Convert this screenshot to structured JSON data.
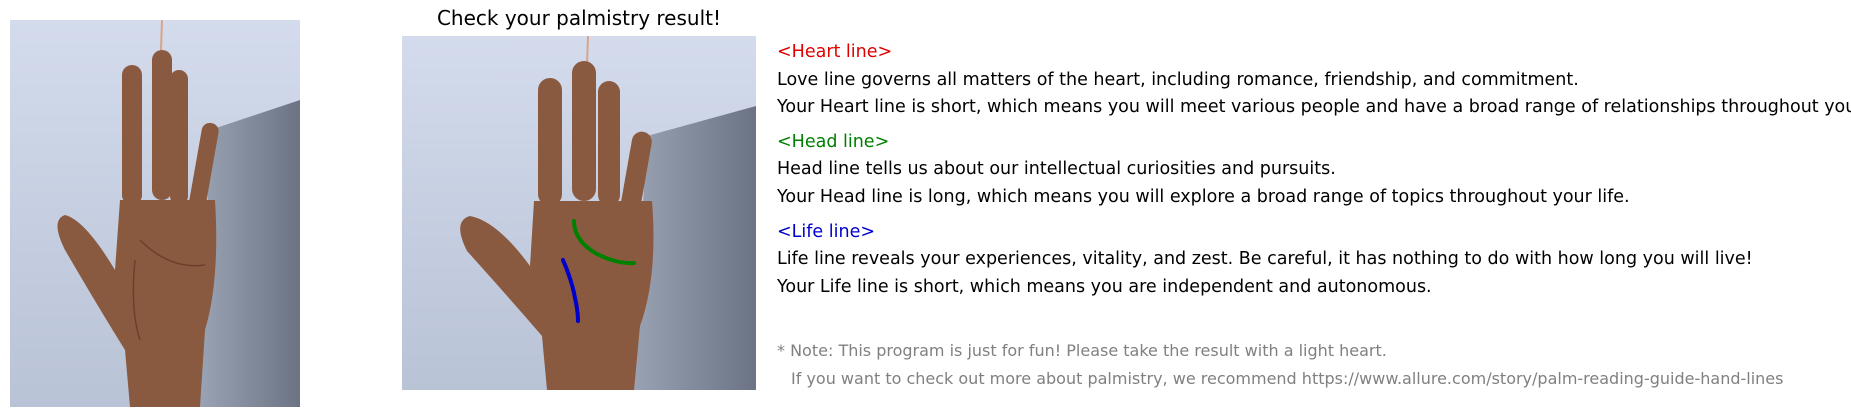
{
  "title": "Check your palmistry result!",
  "colors": {
    "heart": "#e00000",
    "head": "#008000",
    "life": "#0000cc",
    "note": "#808080",
    "background": "#ffffff",
    "photo_background": "#cdd5e6",
    "skin": "#8a5a40"
  },
  "sections": [
    {
      "heading": "<Heart line>",
      "description": "Love line governs all matters of the heart, including romance, friendship, and commitment.",
      "result": "Your Heart line is short, which means you will meet various people and have a broad range of relationships throughout your life."
    },
    {
      "heading": "<Head line>",
      "description": "Head line tells us about our intellectual curiosities and pursuits.",
      "result": "Your Head line is long, which means you will explore a broad range of topics throughout your life."
    },
    {
      "heading": "<Life line>",
      "description": "Life line reveals your experiences, vitality, and zest. Be careful, it has nothing to do with how long you will live!",
      "result": "Your Life line is short, which means you are independent and autonomous."
    }
  ],
  "note": {
    "line1": "* Note: This program is just for fun! Please take the result with a light heart.",
    "line2": "If you want to check out more about palmistry, we recommend https://www.allure.com/story/palm-reading-guide-hand-lines"
  }
}
